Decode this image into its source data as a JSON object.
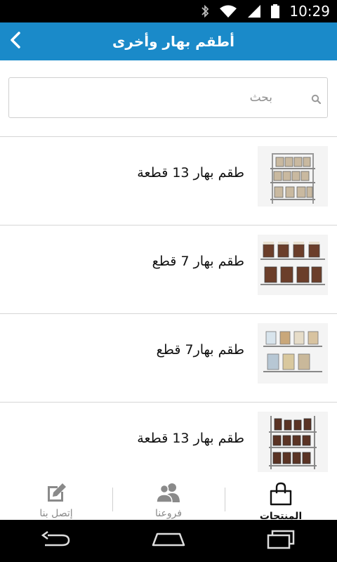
{
  "status_bar": {
    "time": "10:29"
  },
  "header": {
    "title": "أطقم بهار وأخرى"
  },
  "search": {
    "placeholder": "بحث",
    "value": ""
  },
  "products": [
    {
      "name": "طقم بهار 13 قطعة",
      "thumb_style": "rack-3tier-13"
    },
    {
      "name": "طقم بهار 7 قطع",
      "thumb_style": "rack-2tier-dark"
    },
    {
      "name": "طقم بهار7 قطع",
      "thumb_style": "rack-2tier-light"
    },
    {
      "name": "طقم بهار 13 قطعة",
      "thumb_style": "rack-3tier-dark"
    }
  ],
  "tabs": [
    {
      "label": "إتصل بنا",
      "icon": "edit-icon",
      "active": false
    },
    {
      "label": "فروعنا",
      "icon": "people-icon",
      "active": false
    },
    {
      "label": "المنتجات",
      "icon": "shopping-bag-icon",
      "active": true
    }
  ],
  "colors": {
    "app_bar": "#1a8ac9",
    "status_bar": "#000000",
    "nav_bar": "#000000"
  }
}
